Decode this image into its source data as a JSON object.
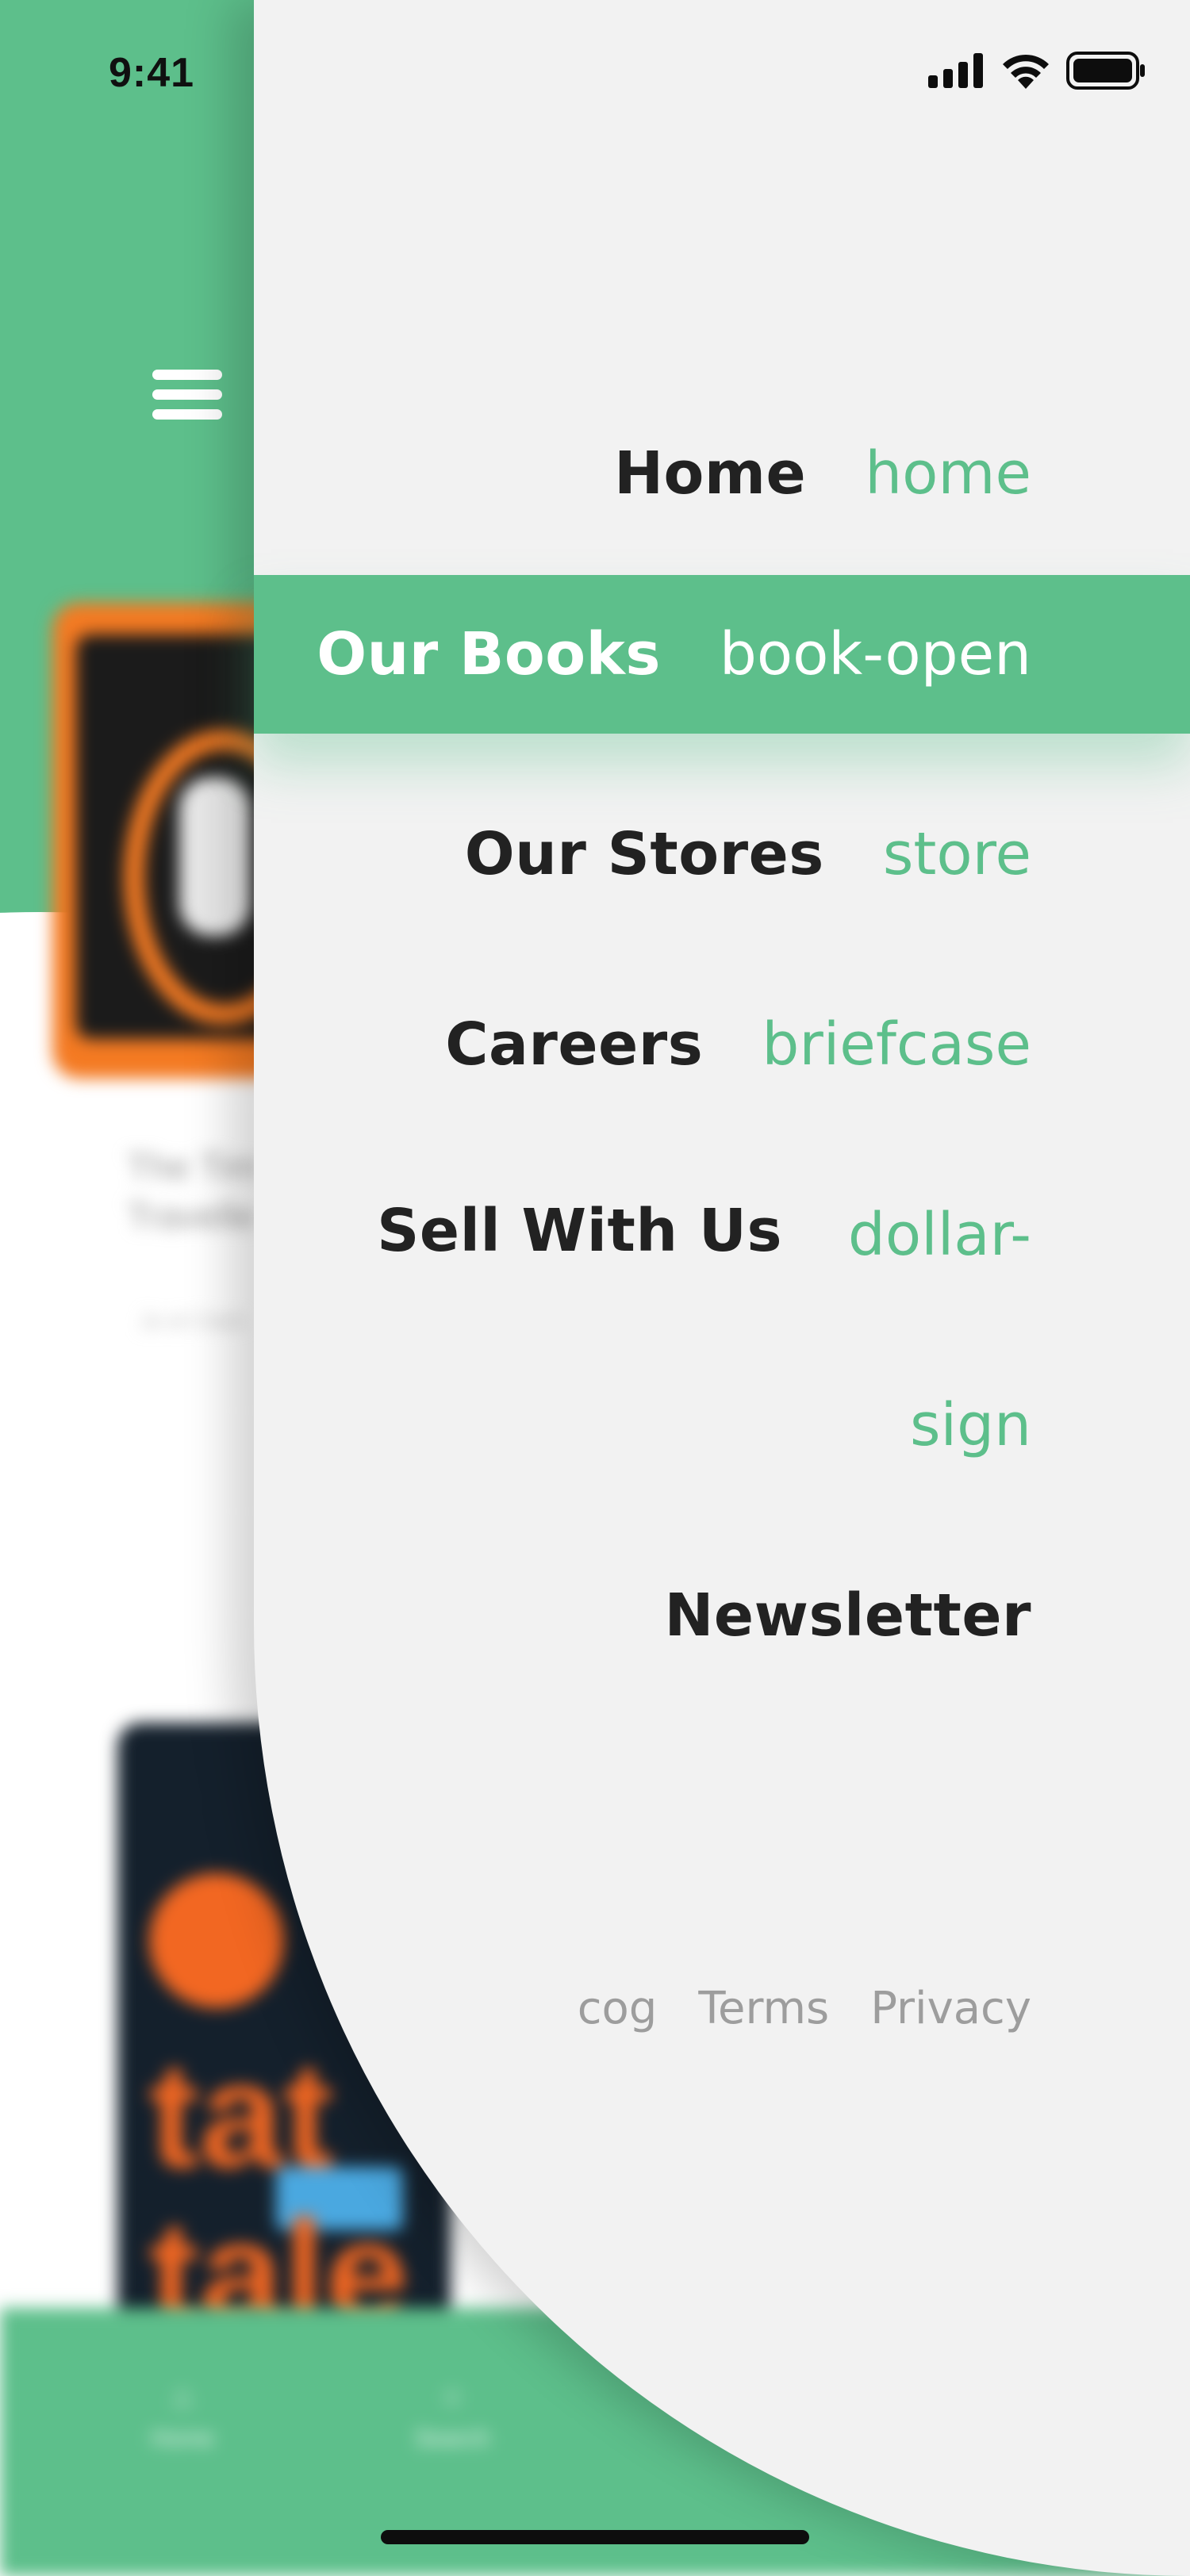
{
  "status_bar": {
    "time": "9:41",
    "icons": [
      "signal-icon",
      "wifi-icon",
      "battery-icon"
    ]
  },
  "background": {
    "book_caption": "The Tim\nTravelle",
    "book_subcaption": "Jo el Clark",
    "book2_word1": "tat",
    "book2_word2": "tale",
    "tabs": [
      {
        "label": "Home",
        "icon": "home-icon"
      },
      {
        "label": "Search",
        "icon": "search-icon"
      }
    ]
  },
  "drawer": {
    "menu": [
      {
        "label": "Home",
        "icon_text": "home",
        "active": false
      },
      {
        "label": "Our Books",
        "icon_text": "book-open",
        "active": true
      },
      {
        "label": "Our Stores",
        "icon_text": "store",
        "active": false
      },
      {
        "label": "Careers",
        "icon_text": "briefcase",
        "active": false
      },
      {
        "label": "Sell With Us",
        "icon_text": "dollar-\nsign",
        "active": false
      },
      {
        "label": "Newsletter",
        "icon_text": "",
        "active": false
      }
    ],
    "footer": {
      "settings": "cog",
      "terms": "Terms",
      "privacy": "Privacy"
    }
  },
  "colors": {
    "accent": "#5dbf8b",
    "drawer_bg": "#f2f2f2",
    "text_dark": "#222222",
    "text_muted": "#9d9d9d"
  }
}
